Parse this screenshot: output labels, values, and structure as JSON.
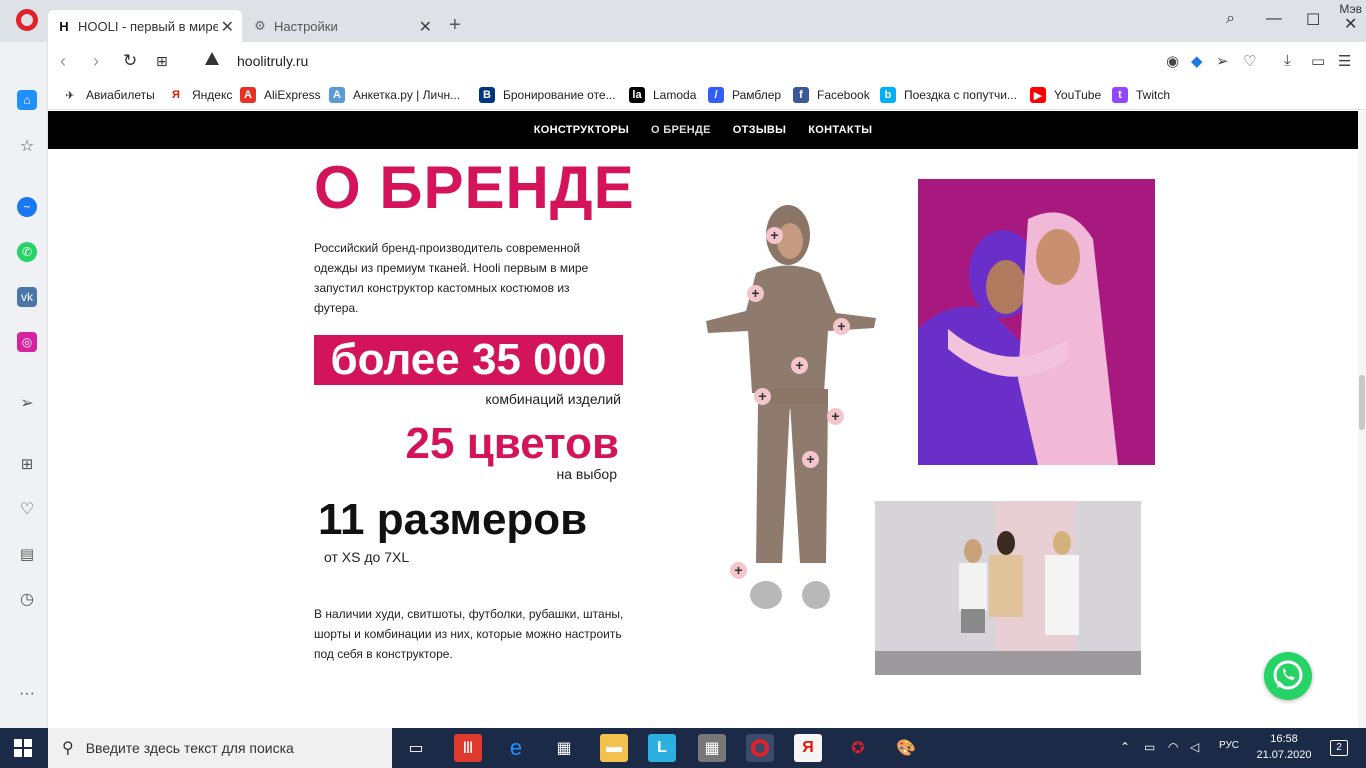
{
  "browser": {
    "tabs": [
      {
        "title": "HOOLI - первый в мире к",
        "favicon": "hooli-logo-icon",
        "active": true
      },
      {
        "title": "Настройки",
        "favicon": "gear-icon",
        "active": false
      }
    ],
    "profile_name": "Мэв",
    "url": "hoolitruly.ru",
    "bookmarks": [
      {
        "label": "Авиабилеты",
        "icon": "plane-icon",
        "color": "#f2a900"
      },
      {
        "label": "Яндекс",
        "icon": "yandex-icon",
        "color": "#e61400"
      },
      {
        "label": "AliExpress",
        "icon": "aliexpress-icon",
        "color": "#e43225"
      },
      {
        "label": "Анкетка.ру | Личн...",
        "icon": "anketka-icon",
        "color": "#5b9bd5"
      },
      {
        "label": "Бронирование оте...",
        "icon": "booking-icon",
        "color": "#003580"
      },
      {
        "label": "Lamoda",
        "icon": "lamoda-icon",
        "color": "#000000"
      },
      {
        "label": "Рамблер",
        "icon": "rambler-icon",
        "color": "#315efb"
      },
      {
        "label": "Facebook",
        "icon": "facebook-icon",
        "color": "#3b5998"
      },
      {
        "label": "Поездка с попутчи...",
        "icon": "blablacar-icon",
        "color": "#00aff5"
      },
      {
        "label": "YouTube",
        "icon": "youtube-icon",
        "color": "#ff0000"
      },
      {
        "label": "Twitch",
        "icon": "twitch-icon",
        "color": "#9146ff"
      }
    ]
  },
  "site": {
    "nav": [
      "КОНСТРУКТОРЫ",
      "О БРЕНДЕ",
      "ОТЗЫВЫ",
      "КОНТАКТЫ"
    ],
    "heading": "О БРЕНДЕ",
    "intro": "Российский бренд-производитель современной одежды из премиум тканей. Hooli первым в мире запустил конструктор кастомных костюмов из футера.",
    "stat1_value": "более 35 000",
    "stat1_caption": "комбинаций изделий",
    "stat2_value": "25 цветов",
    "stat2_caption": "на выбор",
    "stat3_value": "11 размеров",
    "stat3_caption": "от XS до 7XL",
    "outro": "В наличии худи, свитшоты, футболки, рубашки, штаны, шорты и комбинации из них, которые можно настроить под себя в конструкторе.",
    "brand_color": "#d4145a"
  },
  "taskbar": {
    "search_placeholder": "Введите здесь текст для поиска",
    "time": "16:58",
    "date": "21.07.2020",
    "lang": "РУС",
    "notifications": "2"
  }
}
